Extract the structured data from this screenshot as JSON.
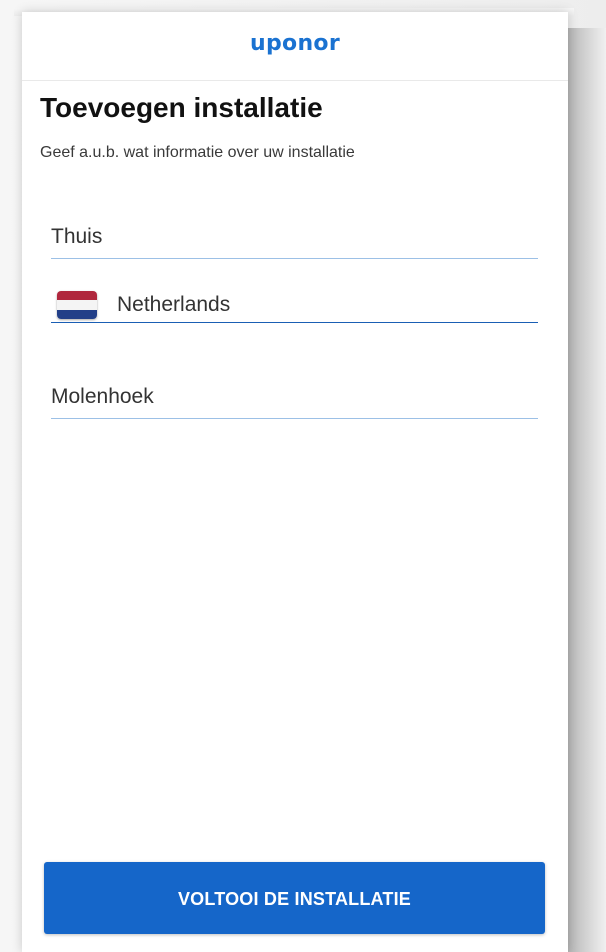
{
  "header": {
    "brand": "uponor"
  },
  "page": {
    "title": "Toevoegen installatie",
    "subtitle": "Geef a.u.b. wat informatie over uw installatie"
  },
  "form": {
    "installation_name": "Thuis",
    "country": {
      "name": "Netherlands",
      "flag_icon": "netherlands-flag-icon",
      "flag_colors": [
        "#b0273d",
        "#f4f4f4",
        "#223f88"
      ]
    },
    "city": "Molenhoek"
  },
  "actions": {
    "complete_label": "VOLTOOI DE INSTALLATIE"
  },
  "colors": {
    "brand": "#1a72d1",
    "primary_button": "#1566c9",
    "active_underline": "#1a5fb4",
    "inactive_underline": "#9cc0e6"
  }
}
